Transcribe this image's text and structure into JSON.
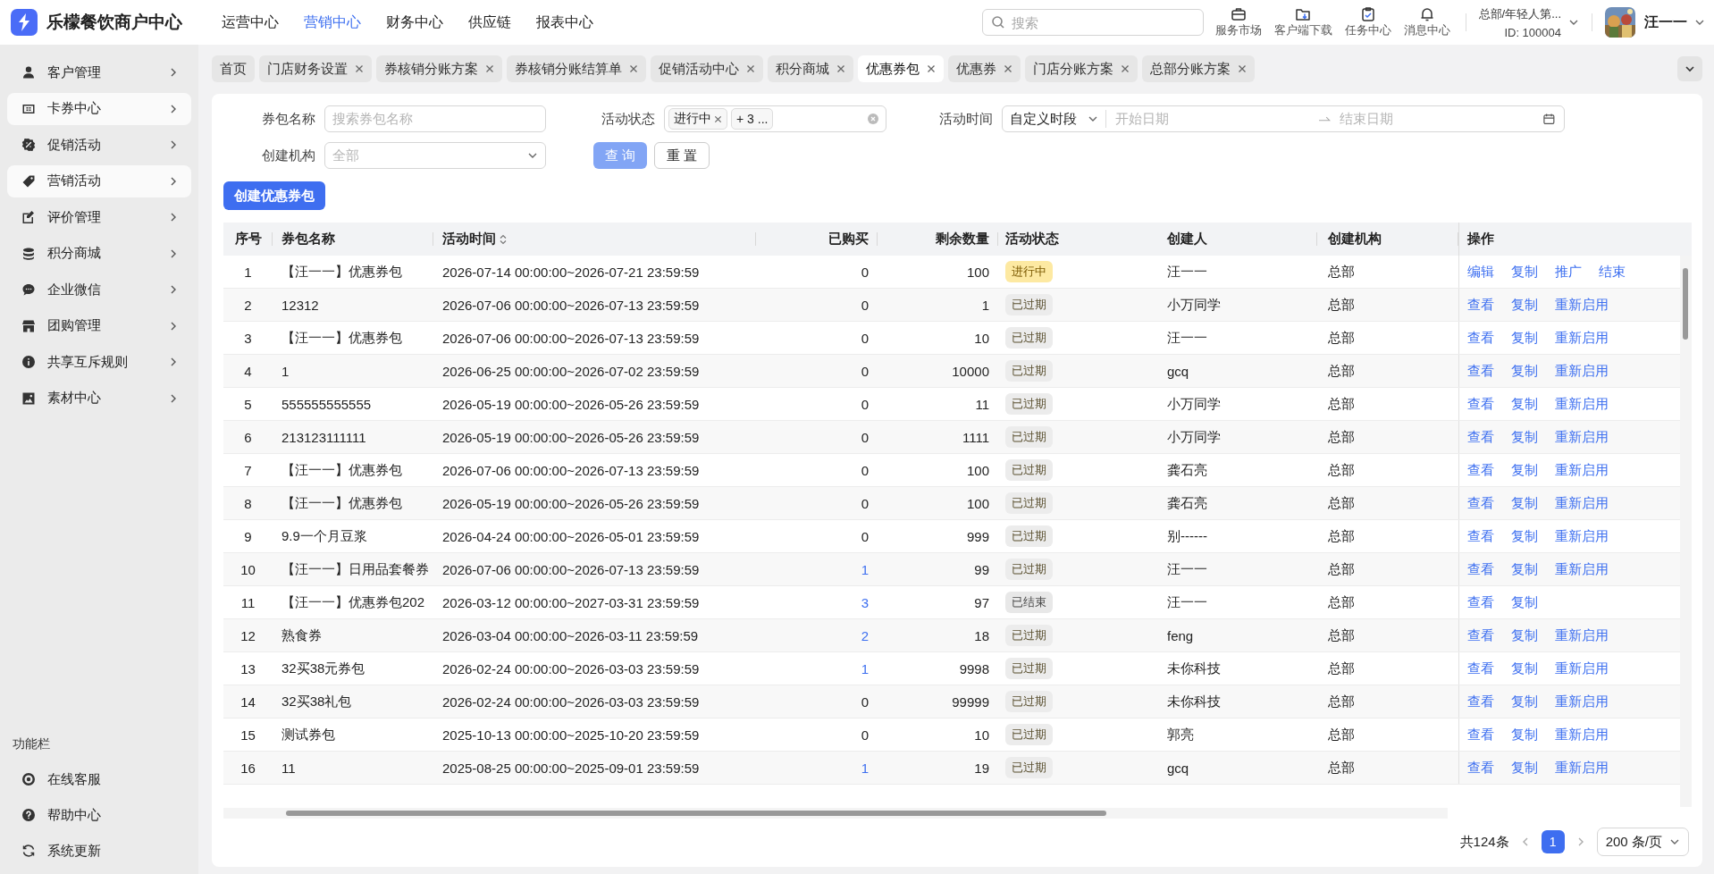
{
  "header": {
    "title": "乐檬餐饮商户中心",
    "nav": [
      {
        "label": "运营中心",
        "selected": false
      },
      {
        "label": "营销中心",
        "selected": true
      },
      {
        "label": "财务中心",
        "selected": false
      },
      {
        "label": "供应链",
        "selected": false
      },
      {
        "label": "报表中心",
        "selected": false
      }
    ],
    "search": {
      "placeholder": "搜索"
    },
    "tools": [
      "服务市场",
      "客户端下载",
      "任务中心",
      "消息中心"
    ],
    "org": "总部/年轻人第...",
    "org_id": "ID: 100004",
    "user": "汪一一"
  },
  "sidebar": {
    "items": [
      {
        "label": "客户管理",
        "selected": false
      },
      {
        "label": "卡券中心",
        "selected": true
      },
      {
        "label": "促销活动",
        "selected": false
      },
      {
        "label": "营销活动",
        "selected": true
      },
      {
        "label": "评价管理",
        "selected": false
      },
      {
        "label": "积分商城",
        "selected": false
      },
      {
        "label": "企业微信",
        "selected": false
      },
      {
        "label": "团购管理",
        "selected": false
      },
      {
        "label": "共享互斥规则",
        "selected": false
      },
      {
        "label": "素材中心",
        "selected": false
      }
    ],
    "section_title": "功能栏",
    "footer_items": [
      "在线客服",
      "帮助中心",
      "系统更新"
    ]
  },
  "tabs": [
    {
      "label": "首页",
      "closable": false,
      "selected": false
    },
    {
      "label": "门店财务设置",
      "closable": true,
      "selected": false
    },
    {
      "label": "券核销分账方案",
      "closable": true,
      "selected": false
    },
    {
      "label": "券核销分账结算单",
      "closable": true,
      "selected": false
    },
    {
      "label": "促销活动中心",
      "closable": true,
      "selected": false
    },
    {
      "label": "积分商城",
      "closable": true,
      "selected": false
    },
    {
      "label": "优惠券包",
      "closable": true,
      "selected": true
    },
    {
      "label": "优惠券",
      "closable": true,
      "selected": false
    },
    {
      "label": "门店分账方案",
      "closable": true,
      "selected": false
    },
    {
      "label": "总部分账方案",
      "closable": true,
      "selected": false
    }
  ],
  "filters": {
    "name": {
      "label": "券包名称",
      "placeholder": "搜索券包名称"
    },
    "status": {
      "label": "活动状态",
      "tags": [
        {
          "label": "进行中",
          "closable": true
        },
        {
          "label": "+ 3 ...",
          "closable": false
        }
      ]
    },
    "time": {
      "label": "活动时间",
      "mode": "自定义时段",
      "start_placeholder": "开始日期",
      "end_placeholder": "结束日期"
    },
    "org": {
      "label": "创建机构",
      "placeholder": "全部"
    },
    "buttons": [
      {
        "label": "查 询",
        "kind": "primary"
      },
      {
        "label": "重 置",
        "kind": "default"
      }
    ]
  },
  "create_button": "创建优惠券包",
  "table": {
    "columns": [
      {
        "label": "序号",
        "sortable": false
      },
      {
        "label": "券包名称",
        "sortable": false
      },
      {
        "label": "活动时间",
        "sortable": true
      },
      {
        "label": "已购买",
        "sortable": false
      },
      {
        "label": "剩余数量",
        "sortable": false
      },
      {
        "label": "活动状态",
        "sortable": false
      },
      {
        "label": "创建人",
        "sortable": false
      },
      {
        "label": "创建机构",
        "sortable": false
      },
      {
        "label": "操作",
        "sortable": false
      }
    ],
    "rows": [
      {
        "no": "1",
        "name": "【汪一一】优惠券包",
        "time": "2026-07-14 00:00:00~2026-07-21 23:59:59",
        "purchased": "0",
        "purchased_link": false,
        "remaining": "100",
        "status": {
          "text": "进行中",
          "kind": "active"
        },
        "creator": "汪一一",
        "org": "总部",
        "actions": [
          "编辑",
          "复制",
          "推广",
          "结束"
        ]
      },
      {
        "no": "2",
        "name": "12312",
        "time": "2026-07-06 00:00:00~2026-07-13 23:59:59",
        "purchased": "0",
        "purchased_link": false,
        "remaining": "1",
        "status": {
          "text": "已过期",
          "kind": "expired"
        },
        "creator": "小万同学",
        "org": "总部",
        "actions": [
          "查看",
          "复制",
          "重新启用"
        ]
      },
      {
        "no": "3",
        "name": "【汪一一】优惠券包",
        "time": "2026-07-06 00:00:00~2026-07-13 23:59:59",
        "purchased": "0",
        "purchased_link": false,
        "remaining": "10",
        "status": {
          "text": "已过期",
          "kind": "expired"
        },
        "creator": "汪一一",
        "org": "总部",
        "actions": [
          "查看",
          "复制",
          "重新启用"
        ]
      },
      {
        "no": "4",
        "name": "1",
        "time": "2026-06-25 00:00:00~2026-07-02 23:59:59",
        "purchased": "0",
        "purchased_link": false,
        "remaining": "10000",
        "status": {
          "text": "已过期",
          "kind": "expired"
        },
        "creator": "gcq",
        "org": "总部",
        "actions": [
          "查看",
          "复制",
          "重新启用"
        ]
      },
      {
        "no": "5",
        "name": "555555555555",
        "time": "2026-05-19 00:00:00~2026-05-26 23:59:59",
        "purchased": "0",
        "purchased_link": false,
        "remaining": "11",
        "status": {
          "text": "已过期",
          "kind": "expired"
        },
        "creator": "小万同学",
        "org": "总部",
        "actions": [
          "查看",
          "复制",
          "重新启用"
        ]
      },
      {
        "no": "6",
        "name": "213123111111",
        "time": "2026-05-19 00:00:00~2026-05-26 23:59:59",
        "purchased": "0",
        "purchased_link": false,
        "remaining": "1111",
        "status": {
          "text": "已过期",
          "kind": "expired"
        },
        "creator": "小万同学",
        "org": "总部",
        "actions": [
          "查看",
          "复制",
          "重新启用"
        ]
      },
      {
        "no": "7",
        "name": "【汪一一】优惠券包",
        "time": "2026-07-06 00:00:00~2026-07-13 23:59:59",
        "purchased": "0",
        "purchased_link": false,
        "remaining": "100",
        "status": {
          "text": "已过期",
          "kind": "expired"
        },
        "creator": "龚石亮",
        "org": "总部",
        "actions": [
          "查看",
          "复制",
          "重新启用"
        ]
      },
      {
        "no": "8",
        "name": "【汪一一】优惠券包",
        "time": "2026-05-19 00:00:00~2026-05-26 23:59:59",
        "purchased": "0",
        "purchased_link": false,
        "remaining": "100",
        "status": {
          "text": "已过期",
          "kind": "expired"
        },
        "creator": "龚石亮",
        "org": "总部",
        "actions": [
          "查看",
          "复制",
          "重新启用"
        ]
      },
      {
        "no": "9",
        "name": "9.9一个月豆浆",
        "time": "2026-04-24 00:00:00~2026-05-01 23:59:59",
        "purchased": "0",
        "purchased_link": false,
        "remaining": "999",
        "status": {
          "text": "已过期",
          "kind": "expired"
        },
        "creator": "别------",
        "org": "总部",
        "actions": [
          "查看",
          "复制",
          "重新启用"
        ]
      },
      {
        "no": "10",
        "name": "【汪一一】日用品套餐券",
        "time": "2026-07-06 00:00:00~2026-07-13 23:59:59",
        "purchased": "1",
        "purchased_link": true,
        "remaining": "99",
        "status": {
          "text": "已过期",
          "kind": "expired"
        },
        "creator": "汪一一",
        "org": "总部",
        "actions": [
          "查看",
          "复制",
          "重新启用"
        ]
      },
      {
        "no": "11",
        "name": "【汪一一】优惠券包202",
        "time": "2026-03-12 00:00:00~2027-03-31 23:59:59",
        "purchased": "3",
        "purchased_link": true,
        "remaining": "97",
        "status": {
          "text": "已结束",
          "kind": "ended"
        },
        "creator": "汪一一",
        "org": "总部",
        "actions": [
          "查看",
          "复制"
        ]
      },
      {
        "no": "12",
        "name": "熟食券",
        "time": "2026-03-04 00:00:00~2026-03-11 23:59:59",
        "purchased": "2",
        "purchased_link": true,
        "remaining": "18",
        "status": {
          "text": "已过期",
          "kind": "expired"
        },
        "creator": "feng",
        "org": "总部",
        "actions": [
          "查看",
          "复制",
          "重新启用"
        ]
      },
      {
        "no": "13",
        "name": "32买38元券包",
        "time": "2026-02-24 00:00:00~2026-03-03 23:59:59",
        "purchased": "1",
        "purchased_link": true,
        "remaining": "9998",
        "status": {
          "text": "已过期",
          "kind": "expired"
        },
        "creator": "未你科技",
        "org": "总部",
        "actions": [
          "查看",
          "复制",
          "重新启用"
        ]
      },
      {
        "no": "14",
        "name": "32买38礼包",
        "time": "2026-02-24 00:00:00~2026-03-03 23:59:59",
        "purchased": "0",
        "purchased_link": false,
        "remaining": "99999",
        "status": {
          "text": "已过期",
          "kind": "expired"
        },
        "creator": "未你科技",
        "org": "总部",
        "actions": [
          "查看",
          "复制",
          "重新启用"
        ]
      },
      {
        "no": "15",
        "name": "测试券包",
        "time": "2025-10-13 00:00:00~2025-10-20 23:59:59",
        "purchased": "0",
        "purchased_link": false,
        "remaining": "10",
        "status": {
          "text": "已过期",
          "kind": "expired"
        },
        "creator": "郭亮",
        "org": "总部",
        "actions": [
          "查看",
          "复制",
          "重新启用"
        ]
      },
      {
        "no": "16",
        "name": "11",
        "time": "2025-08-25 00:00:00~2025-09-01 23:59:59",
        "purchased": "1",
        "purchased_link": true,
        "remaining": "19",
        "status": {
          "text": "已过期",
          "kind": "expired"
        },
        "creator": "gcq",
        "org": "总部",
        "actions": [
          "查看",
          "复制",
          "重新启用"
        ]
      }
    ]
  },
  "pagination": {
    "total": "共124条",
    "pages": [
      {
        "label": "1",
        "selected": true
      }
    ],
    "page_size": "200 条/页"
  }
}
